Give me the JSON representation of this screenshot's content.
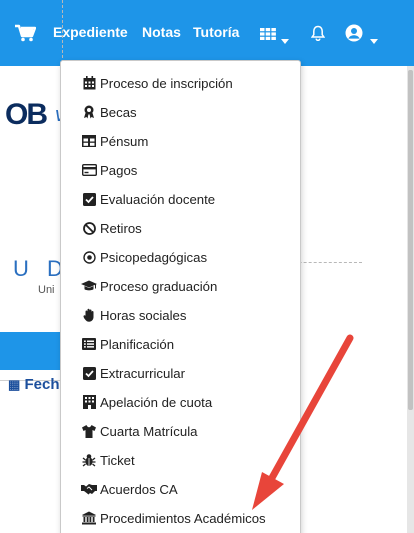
{
  "navbar": {
    "links": [
      {
        "label": "Expediente"
      },
      {
        "label": "Notas"
      },
      {
        "label": "Tutoría"
      }
    ],
    "icons": [
      "cart-icon",
      "grid-menu-icon",
      "chevron-down-icon",
      "bell-icon",
      "user-circle-icon",
      "chevron-down-icon"
    ]
  },
  "background": {
    "logo": "OB",
    "logo_suffix": "v",
    "university_letters": "U D",
    "university_text": "Uni",
    "section_label": "Fech"
  },
  "dropdown": {
    "items": [
      {
        "label": "Proceso de inscripción",
        "icon": "calendar-icon"
      },
      {
        "label": "Becas",
        "icon": "award-icon"
      },
      {
        "label": "Pénsum",
        "icon": "table-icon"
      },
      {
        "label": "Pagos",
        "icon": "credit-card-icon"
      },
      {
        "label": "Evaluación docente",
        "icon": "check-square-icon"
      },
      {
        "label": "Retiros",
        "icon": "ban-icon"
      },
      {
        "label": "Psicopedagógicas",
        "icon": "dot-circle-icon"
      },
      {
        "label": "Proceso graduación",
        "icon": "graduation-cap-icon"
      },
      {
        "label": "Horas sociales",
        "icon": "hand-icon"
      },
      {
        "label": "Planificación",
        "icon": "list-alt-icon"
      },
      {
        "label": "Extracurricular",
        "icon": "check-square-icon"
      },
      {
        "label": "Apelación de cuota",
        "icon": "building-icon"
      },
      {
        "label": "Cuarta Matrícula",
        "icon": "shirt-icon"
      },
      {
        "label": "Ticket",
        "icon": "bug-icon"
      },
      {
        "label": "Acuerdos CA",
        "icon": "handshake-icon"
      },
      {
        "label": "Procedimientos Académicos",
        "icon": "university-icon"
      }
    ]
  },
  "colors": {
    "navbar": "#1e95e8",
    "annotation_arrow": "#e8453a"
  }
}
